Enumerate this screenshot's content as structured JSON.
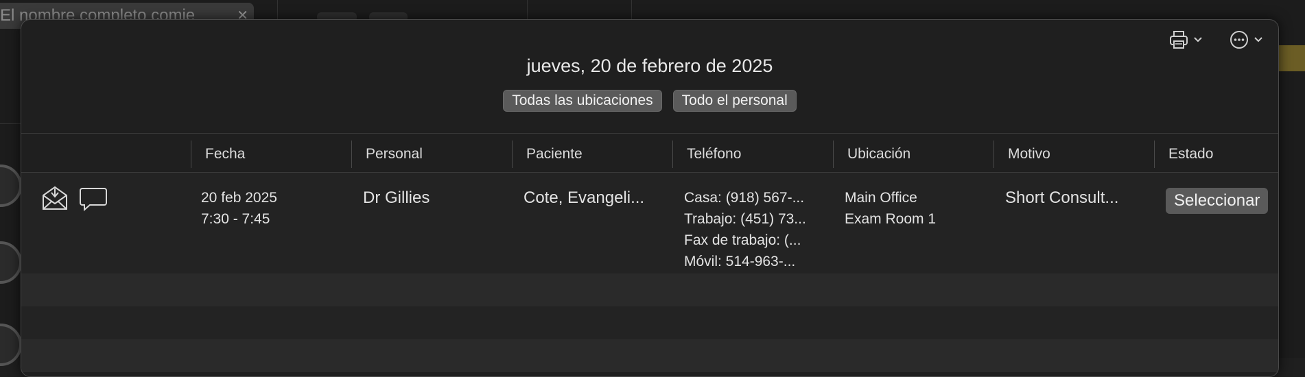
{
  "background": {
    "search_placeholder": "El nombre completo comie",
    "accent_color": "#6b5d25"
  },
  "toolbar": {
    "print_icon": "printer-icon",
    "more_icon": "ellipsis-circle-icon"
  },
  "header": {
    "date_title": "jueves, 20 de febrero de 2025",
    "filter_locations": "Todas las ubicaciones",
    "filter_staff": "Todo el personal"
  },
  "table": {
    "columns": [
      "Fecha",
      "Personal",
      "Paciente",
      "Teléfono",
      "Ubicación",
      "Motivo",
      "Estado"
    ],
    "rows": [
      {
        "icons": [
          "envelope-icon",
          "chat-bubble-icon"
        ],
        "date": "20 feb 2025",
        "time": "7:30 - 7:45",
        "staff": "Dr Gillies",
        "patient": "Cote, Evangeli...",
        "phones": [
          "Casa: (918) 567-...",
          "Trabajo: (451) 73...",
          "Fax de trabajo: (...",
          "Móvil: 514-963-..."
        ],
        "location": [
          "Main Office",
          "Exam Room 1"
        ],
        "reason": "Short Consult...",
        "status": "Seleccionar"
      }
    ]
  }
}
